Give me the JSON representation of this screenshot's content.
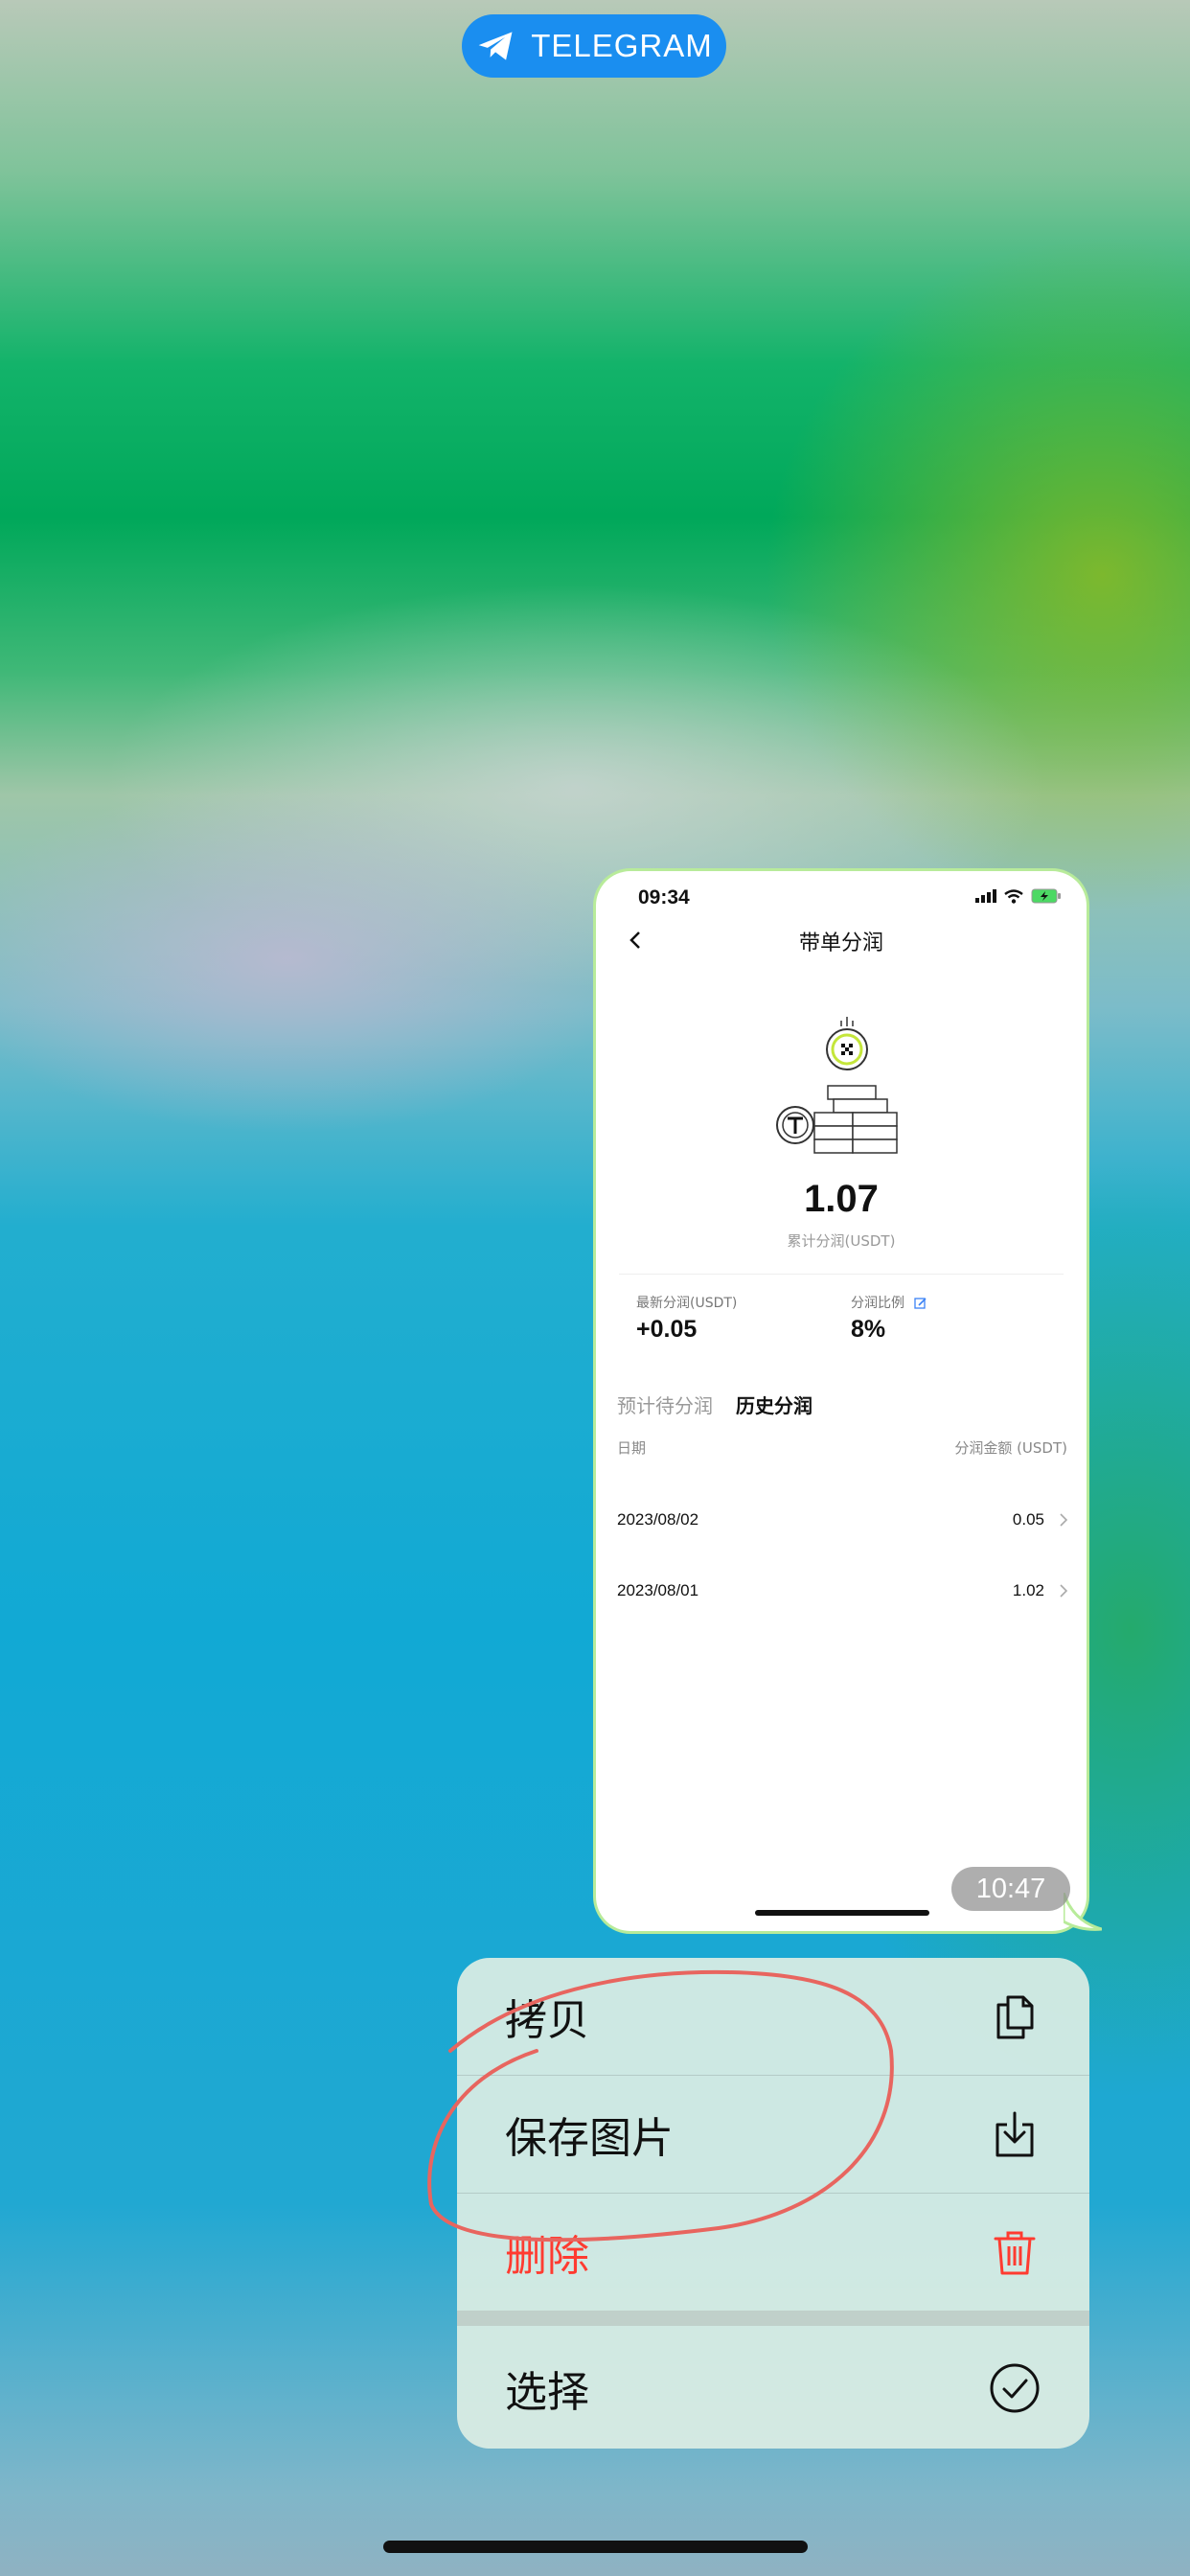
{
  "app": {
    "return_pill_label": "TELEGRAM"
  },
  "message": {
    "timestamp": "10:47",
    "screenshot": {
      "status_time": "09:34",
      "page_title": "带单分润",
      "total_value": "1.07",
      "total_label": "累计分润(USDT)",
      "stats": [
        {
          "label": "最新分润(USDT)",
          "value": "+0.05"
        },
        {
          "label": "分润比例",
          "value": "8%"
        }
      ],
      "tabs": [
        {
          "label": "预计待分润",
          "active": false
        },
        {
          "label": "历史分润",
          "active": true
        }
      ],
      "table": {
        "col_date": "日期",
        "col_amount": "分润金额 (USDT)",
        "rows": [
          {
            "date": "2023/08/02",
            "amount": "0.05"
          },
          {
            "date": "2023/08/01",
            "amount": "1.02"
          }
        ]
      }
    }
  },
  "context_menu": {
    "items": [
      {
        "label": "拷贝",
        "icon": "copy-icon"
      },
      {
        "label": "保存图片",
        "icon": "save-download-icon"
      },
      {
        "label": "删除",
        "icon": "trash-icon",
        "color": "#ff3b30"
      },
      {
        "label": "选择",
        "icon": "checkmark-circle-icon"
      }
    ]
  }
}
